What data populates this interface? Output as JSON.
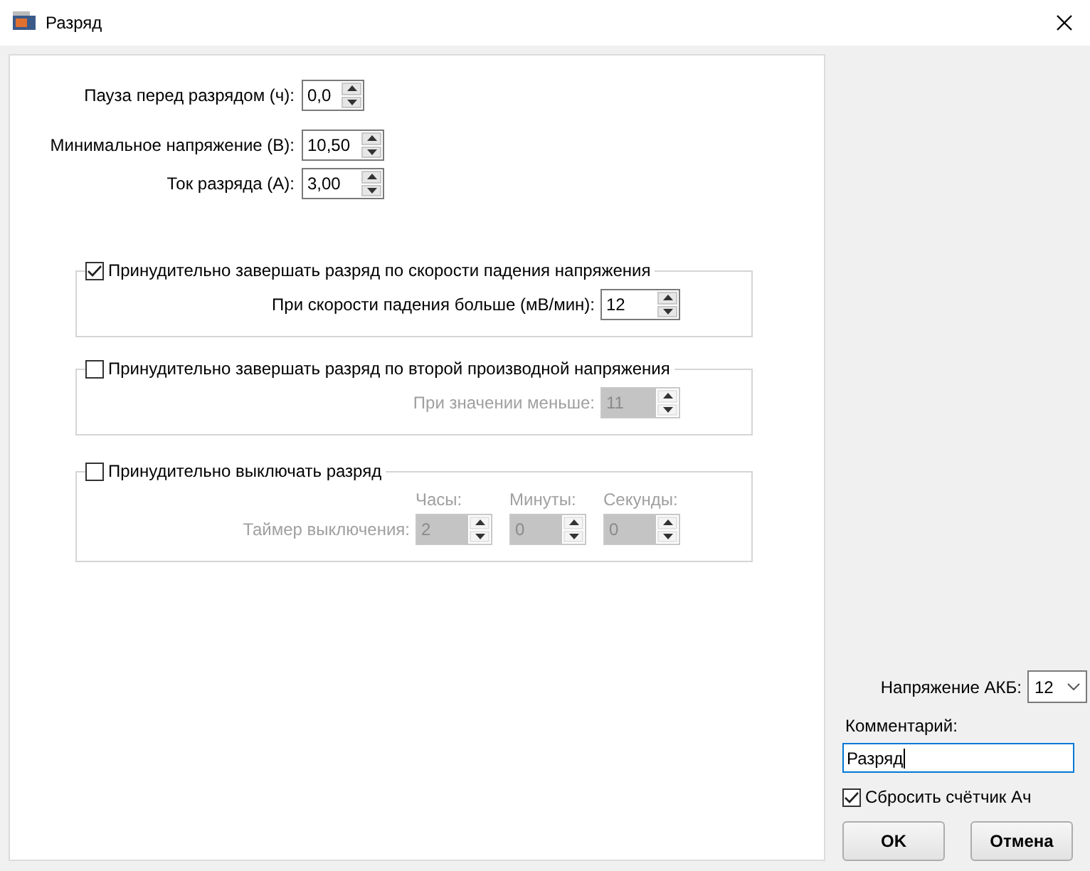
{
  "window": {
    "title": "Разряд"
  },
  "fields": [
    {
      "label": "Пауза перед разрядом (ч):",
      "value": "0,0"
    },
    {
      "label": "Минимальное напряжение (В):",
      "value": "10,50"
    },
    {
      "label": "Ток разряда (А):",
      "value": "3,00"
    }
  ],
  "groups": [
    {
      "kind": "single",
      "title": "Принудительно завершать разряд по скорости падения напряжения",
      "checked": true,
      "disabled": false,
      "label": "При скорости падения больше (мВ/мин):",
      "value": "12"
    },
    {
      "kind": "single",
      "title": "Принудительно завершать разряд по второй производной напряжения",
      "checked": false,
      "disabled": true,
      "label": "При значении меньше:",
      "value": "11"
    },
    {
      "kind": "timer",
      "title": "Принудительно выключать разряд",
      "checked": false,
      "disabled": true,
      "label": "Таймер выключения:",
      "spinners": [
        {
          "caption": "Часы:",
          "value": "2"
        },
        {
          "caption": "Минуты:",
          "value": "0"
        },
        {
          "caption": "Секунды:",
          "value": "0"
        }
      ]
    }
  ],
  "battery_voltage": {
    "label": "Напряжение АКБ:",
    "value": "12"
  },
  "comment": {
    "label": "Комментарий:",
    "value": "Разряд"
  },
  "reset_counter": {
    "label": "Сбросить счётчик Ач",
    "checked": true
  },
  "buttons": [
    "OK",
    "Отмена"
  ]
}
